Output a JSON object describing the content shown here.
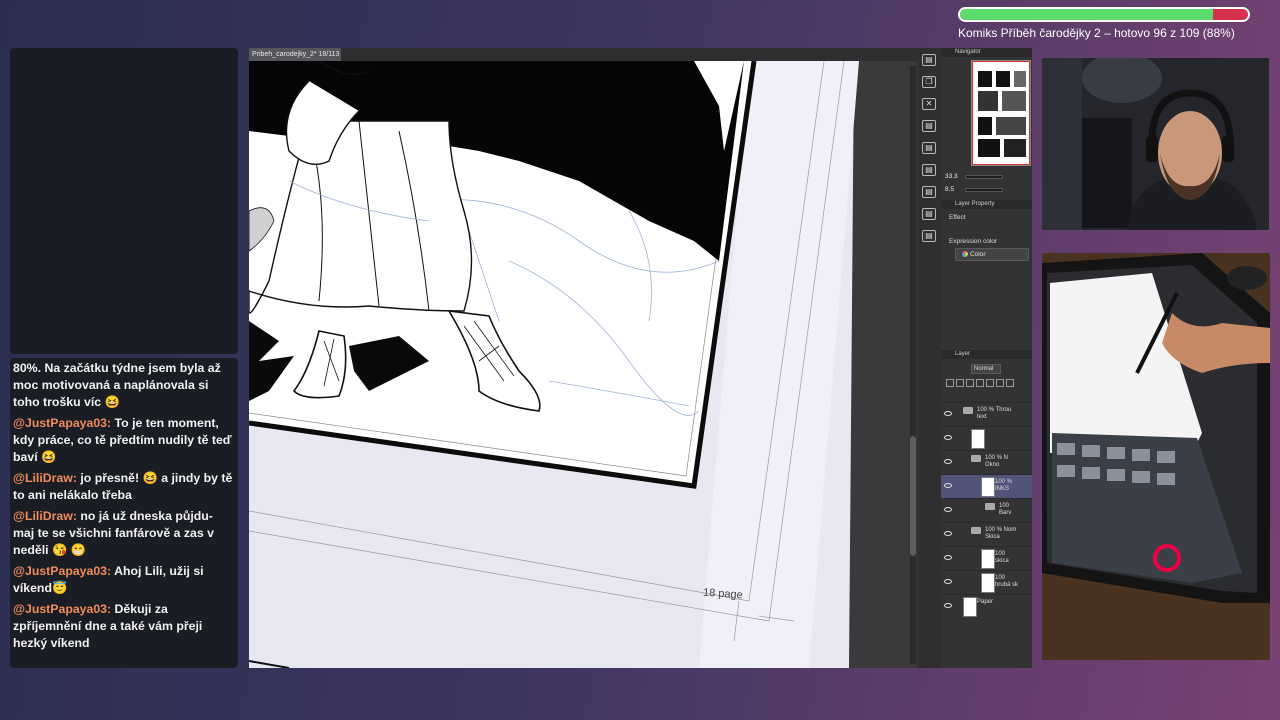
{
  "progress": {
    "label": "Komiks Příběh čarodějky 2 – hotovo 96 z 109 (88%)",
    "fraction": 0.88,
    "fill_color": "#5cdc6c",
    "track_color": "#d6304c"
  },
  "chat": {
    "messages": [
      {
        "user": "",
        "text": "80%. Na začátku týdne jsem byla až moc motivovaná a naplánovala si toho trošku víc 😆"
      },
      {
        "user": "@JustPapaya03:",
        "text": "To je ten moment, kdy práce, co tě předtím nudily tě teď baví 😆"
      },
      {
        "user": "@LiliDraw:",
        "text": "jo přesně! 😆 a jindy by tě to ani nelákalo třeba"
      },
      {
        "user": "@LiliDraw:",
        "text": "no já už dneska půjdu- maj te se všichni fanfárově a zas v neděli 😘 😁"
      },
      {
        "user": "@JustPapaya03:",
        "text": "Ahoj Lili, užij si víkend😇"
      },
      {
        "user": "@JustPapaya03:",
        "text": "Děkuji za zpříjemnění dne a také vám přeji hezký víkend"
      }
    ]
  },
  "canvas": {
    "tab_title": "Pribeh_carodejky_2* 18/113",
    "page_label": "18 page"
  },
  "navigator": {
    "title": "Navigator",
    "zoom": "33.3",
    "rotation": "8.5"
  },
  "layer_property": {
    "title": "Layer Property",
    "effect_label": "Effect",
    "expression_label": "Expression color",
    "expression_value": "Color"
  },
  "layer_panel": {
    "title": "Layer",
    "blend_mode": "Normal",
    "layers": [
      {
        "name": "100 % Throu\ntext",
        "type": "folder"
      },
      {
        "name": "",
        "type": "layer"
      },
      {
        "name": "100 % N\nOkno",
        "type": "folder"
      },
      {
        "name": "100 %\nINKS",
        "type": "layer",
        "selected": true
      },
      {
        "name": "100\nBarv",
        "type": "folder"
      },
      {
        "name": "100 % Nom\nSkica",
        "type": "folder"
      },
      {
        "name": "100\nskica",
        "type": "layer"
      },
      {
        "name": "100\nhrubá sk",
        "type": "layer"
      },
      {
        "name": "Paper",
        "type": "paper"
      }
    ]
  },
  "icons": [
    "layer-icon",
    "copy-icon",
    "close-icon",
    "layer-icon",
    "layer-icon",
    "layer-icon",
    "layer-icon",
    "layer-icon",
    "layer-icon"
  ]
}
